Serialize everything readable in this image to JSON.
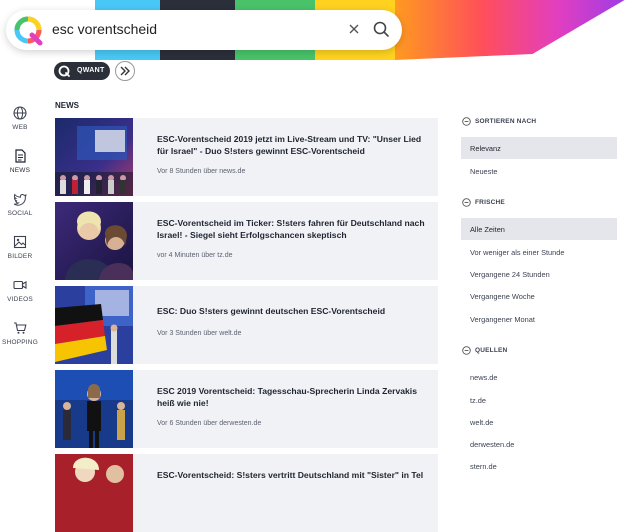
{
  "search": {
    "query": "esc vorentscheid"
  },
  "toolbar": {
    "qwant_label": "QWANT"
  },
  "nav": {
    "items": [
      {
        "label": "WEB"
      },
      {
        "label": "NEWS"
      },
      {
        "label": "SOCIAL"
      },
      {
        "label": "BILDER"
      },
      {
        "label": "VIDEOS"
      },
      {
        "label": "SHOPPING"
      }
    ]
  },
  "main": {
    "section_title": "NEWS",
    "results": [
      {
        "title": "ESC-Vorentscheid 2019 jetzt im Live-Stream und TV: \"Unser Lied für Israel\" - Duo S!sters gewinnt ESC-Vorentscheid",
        "meta": "Vor 8 Stunden über news.de"
      },
      {
        "title": "ESC-Vorentscheid im Ticker: S!sters fahren für Deutschland nach Israel! - Siegel sieht Erfolgschancen skeptisch",
        "meta": "vor 4 Minuten über tz.de"
      },
      {
        "title": "ESC: Duo S!sters gewinnt deutschen ESC-Vorentscheid",
        "meta": "Vor 3 Stunden über welt.de"
      },
      {
        "title": "ESC 2019 Vorentscheid: Tagesschau-Sprecherin Linda Zervakis heiß wie nie!",
        "meta": "Vor 6 Stunden über derwesten.de"
      },
      {
        "title": "ESC-Vorentscheid: S!sters vertritt Deutschland mit \"Sister\" in Tel",
        "meta": ""
      }
    ]
  },
  "filters": {
    "sort": {
      "heading": "SORTIEREN NACH",
      "options": [
        "Relevanz",
        "Neueste"
      ],
      "selected": "Relevanz"
    },
    "fresh": {
      "heading": "FRISCHE",
      "options": [
        "Alle Zeiten",
        "Vor weniger als einer Stunde",
        "Vergangene 24 Stunden",
        "Vergangene Woche",
        "Vergangener Monat"
      ],
      "selected": "Alle Zeiten"
    },
    "sources": {
      "heading": "QUELLEN",
      "options": [
        "news.de",
        "tz.de",
        "welt.de",
        "derwesten.de",
        "stern.de"
      ]
    }
  },
  "colors": {
    "accent": "#5c97ff",
    "card_bg": "#f0f2f6",
    "selected_bg": "#e4e6eb",
    "text": "#1f2430"
  }
}
